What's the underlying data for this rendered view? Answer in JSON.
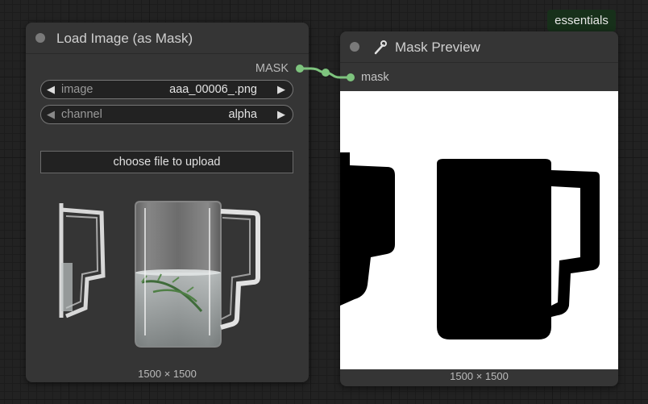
{
  "badge": "essentials",
  "load_node": {
    "title": "Load Image (as Mask)",
    "output_label": "MASK",
    "image_widget": {
      "label": "image",
      "value": "aaa_00006_.png"
    },
    "channel_widget": {
      "label": "channel",
      "value": "alpha"
    },
    "upload_label": "choose file to upload",
    "dimensions": "1500 × 1500"
  },
  "preview_node": {
    "title": "Mask Preview",
    "input_label": "mask",
    "dimensions": "1500 × 1500"
  },
  "colors": {
    "link": "#7ec47e",
    "node_bg": "#353535",
    "canvas_bg": "#222222",
    "badge_bg": "#1d3b1d"
  }
}
